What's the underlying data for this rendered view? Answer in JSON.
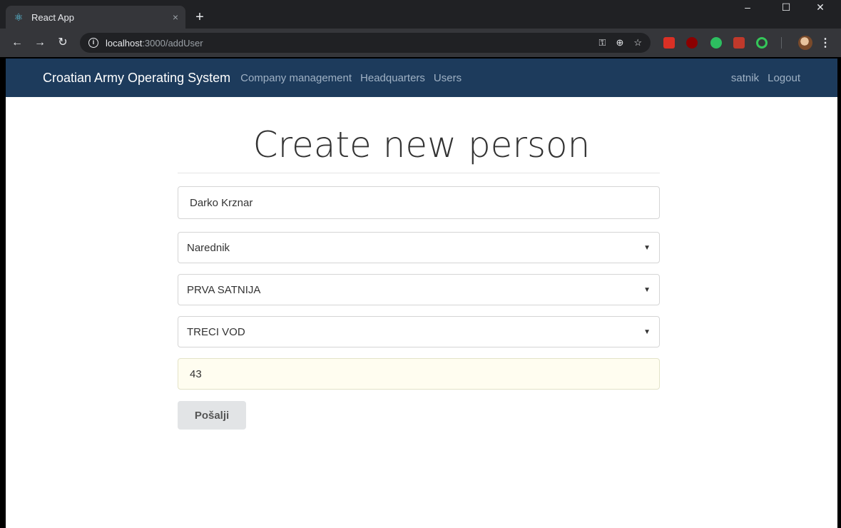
{
  "browser": {
    "tab_title": "React App",
    "tab_close": "×",
    "new_tab": "+",
    "url_host": "localhost",
    "url_path": ":3000/addUser",
    "window_controls": [
      "–",
      "☐",
      "✕"
    ]
  },
  "navbar": {
    "brand": "Croatian Army Operating System",
    "links": [
      "Company management",
      "Headquarters",
      "Users"
    ],
    "user": "satnik",
    "logout": "Logout",
    "bg_color": "#1d3b5c"
  },
  "form": {
    "title": "Create new person",
    "name_value": "Darko Krznar",
    "rank_selected": "Narednik",
    "company_selected": "PRVA SATNIJA",
    "platoon_selected": "TRECI VOD",
    "number_value": "43",
    "submit_label": "Pošalji"
  }
}
